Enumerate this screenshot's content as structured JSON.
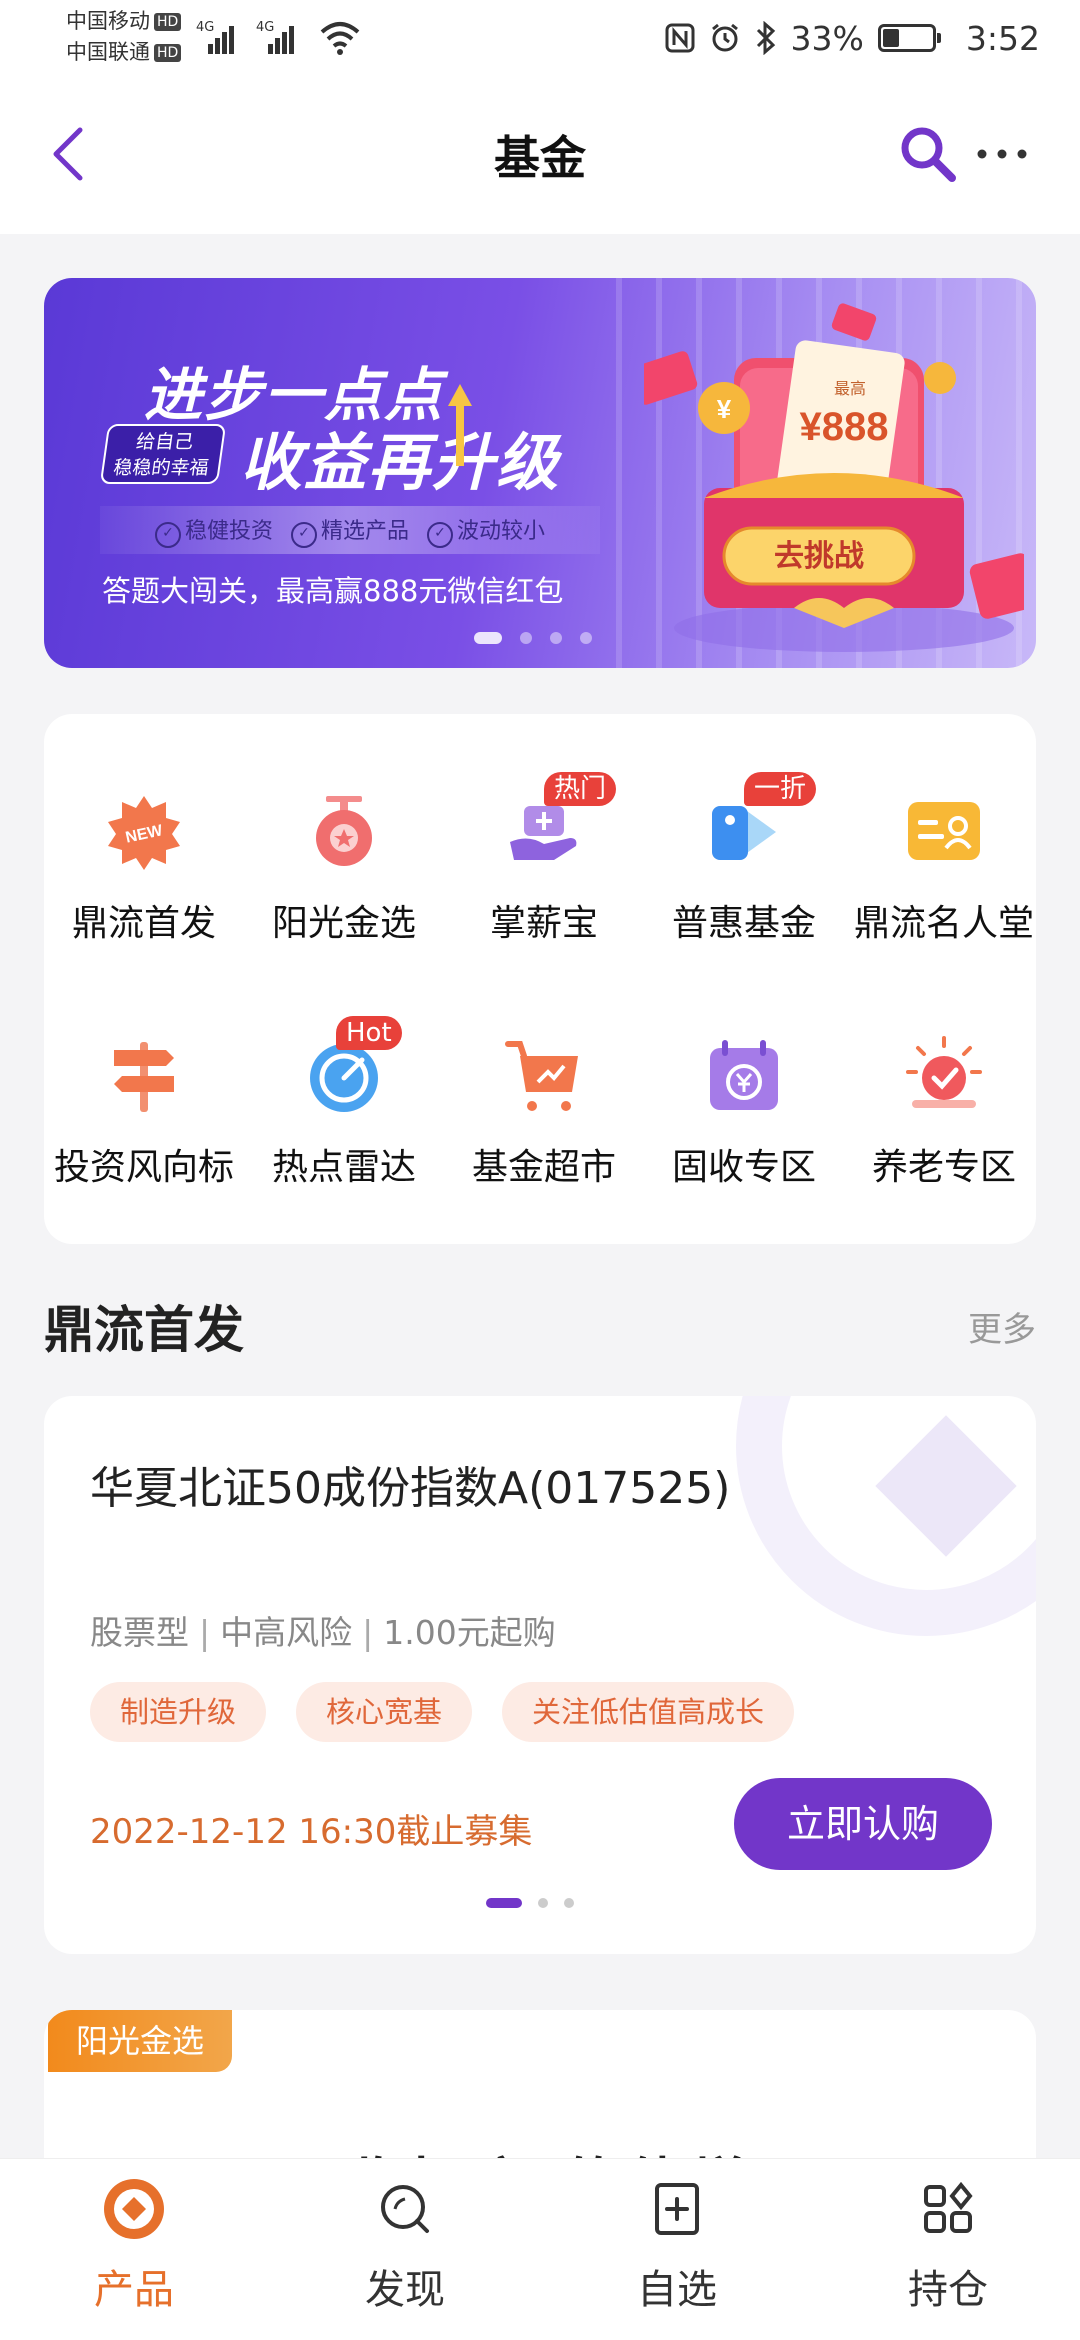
{
  "status_bar": {
    "carrier1": "中国移动",
    "carrier2": "中国联通",
    "hd": "HD",
    "net1": "4G",
    "net2": "4G",
    "battery_percent": "33%",
    "battery_level": 0.33,
    "time": "3:52"
  },
  "header": {
    "title": "基金"
  },
  "banner": {
    "headline1": "进步一点点",
    "sub_badge_line1": "给自己",
    "sub_badge_line2": "稳稳的幸福",
    "headline2": "收益再升级",
    "tags": [
      "稳健投资",
      "精选产品",
      "波动较小"
    ],
    "description": "答题大闯关，最高赢888元微信红包",
    "ticket_top": "最高",
    "ticket_amount": "¥888",
    "coin_symbol": "¥",
    "cta": "去挑战",
    "slide_count": 4,
    "active_slide": 0
  },
  "menu": {
    "row1": [
      {
        "label": "鼎流首发",
        "badge": ""
      },
      {
        "label": "阳光金选",
        "badge": ""
      },
      {
        "label": "掌薪宝",
        "badge": "热门"
      },
      {
        "label": "普惠基金",
        "badge": "一折"
      },
      {
        "label": "鼎流名人堂",
        "badge": ""
      }
    ],
    "row2": [
      {
        "label": "投资风向标",
        "badge": ""
      },
      {
        "label": "热点雷达",
        "badge": "Hot"
      },
      {
        "label": "基金超市",
        "badge": ""
      },
      {
        "label": "固收专区",
        "badge": ""
      },
      {
        "label": "养老专区",
        "badge": ""
      }
    ],
    "new_icon_text": "NEW"
  },
  "section": {
    "title": "鼎流首发",
    "more": "更多"
  },
  "fund": {
    "name": "华夏北证50成份指数A(017525)",
    "type": "股票型",
    "risk": "中高风险",
    "min_buy": "1.00元起购",
    "sep": "|",
    "tags": [
      "制造升级",
      "核心宽基",
      "关注低估值高成长"
    ],
    "deadline": "2022-12-12 16:30截止募集",
    "buy_button": "立即认购"
  },
  "next_section": {
    "tag": "阳光金选",
    "headline": "固收打底 软债增强"
  },
  "bottom_nav": [
    {
      "label": "产品",
      "icon": "product-icon",
      "active": true
    },
    {
      "label": "发现",
      "icon": "discover-icon",
      "active": false
    },
    {
      "label": "自选",
      "icon": "watchlist-icon",
      "active": false
    },
    {
      "label": "持仓",
      "icon": "holdings-icon",
      "active": false
    }
  ],
  "colors": {
    "brand_purple": "#7236c9",
    "accent_orange": "#e6702b",
    "tag_text": "#e0673a",
    "tag_bg": "#fdebe4"
  }
}
